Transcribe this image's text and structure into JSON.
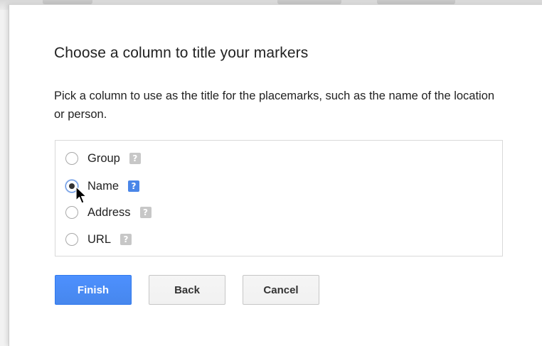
{
  "dialog": {
    "title": "Choose a column to title your markers",
    "description": "Pick a column to use as the title for the placemarks, such as the name of the location or person."
  },
  "options": [
    {
      "label": "Group",
      "checked": false,
      "help_icon": "question-icon"
    },
    {
      "label": "Name",
      "checked": true,
      "help_icon": "question-icon"
    },
    {
      "label": "Address",
      "checked": false,
      "help_icon": "question-icon"
    },
    {
      "label": "URL",
      "checked": false,
      "help_icon": "question-icon"
    }
  ],
  "help_glyph": "?",
  "buttons": {
    "finish": "Finish",
    "back": "Back",
    "cancel": "Cancel"
  },
  "colors": {
    "primary": "#4d90fe",
    "help_active": "#4a86e8",
    "help_inactive": "#c7c7c7"
  }
}
